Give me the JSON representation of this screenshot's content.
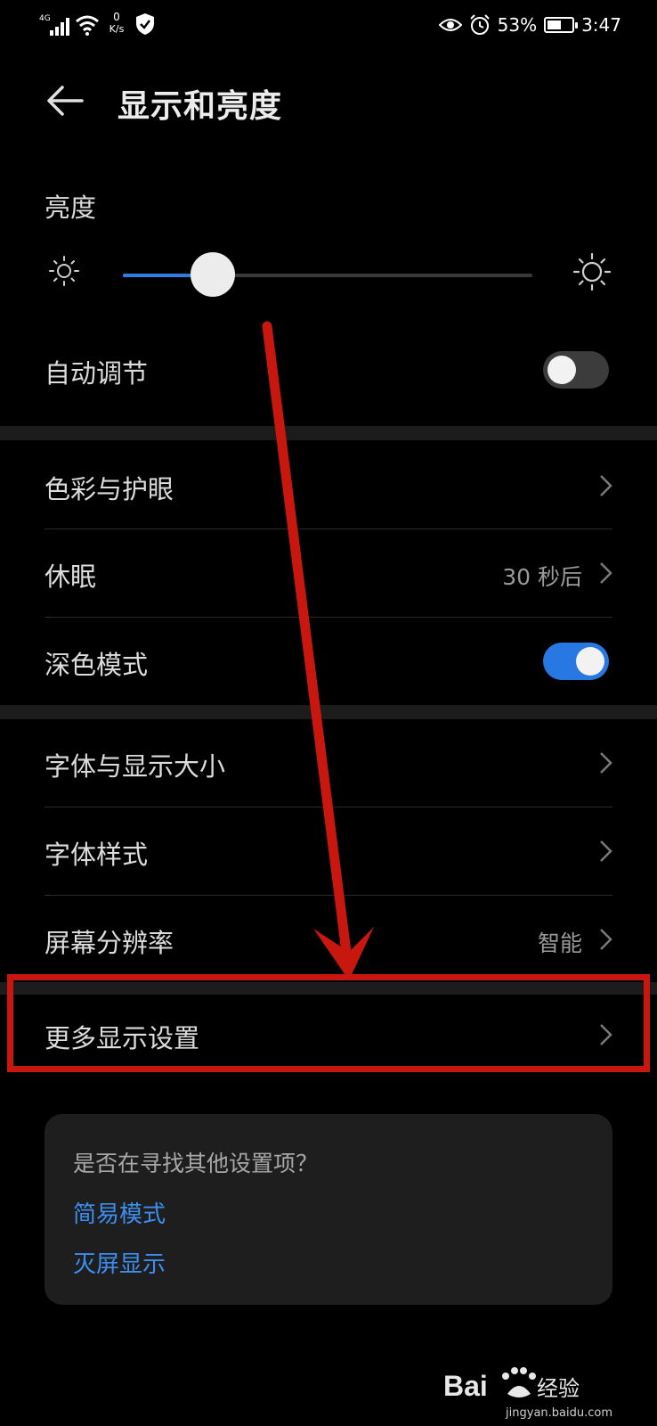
{
  "status_bar": {
    "network": "4G",
    "speed_value": "0",
    "speed_unit": "K/s",
    "battery_percent": "53%",
    "battery_level": 0.53,
    "time": "3:47",
    "icons": [
      "signal-icon",
      "wifi-icon",
      "shield-icon",
      "eye-icon",
      "alarm-icon",
      "battery-icon"
    ]
  },
  "header": {
    "title": "显示和亮度",
    "back_icon": "back-arrow-icon"
  },
  "brightness": {
    "label": "亮度",
    "level": 0.22,
    "accent_color": "#2f7de1"
  },
  "settings": {
    "auto_adjust": {
      "label": "自动调节",
      "enabled": false
    },
    "color_eye": {
      "label": "色彩与护眼"
    },
    "sleep": {
      "label": "休眠",
      "value": "30 秒后"
    },
    "dark_mode": {
      "label": "深色模式",
      "enabled": true
    },
    "font_display_size": {
      "label": "字体与显示大小"
    },
    "font_style": {
      "label": "字体样式"
    },
    "resolution": {
      "label": "屏幕分辨率",
      "value": "智能"
    },
    "more_display": {
      "label": "更多显示设置"
    }
  },
  "suggestion": {
    "question": "是否在寻找其他设置项？",
    "links": [
      "简易模式",
      "灭屏显示"
    ],
    "link_color": "#3d8ef0"
  },
  "annotation": {
    "color": "#c8170f"
  },
  "watermark": {
    "brand": "Bai",
    "brand_suffix": "经验",
    "url": "jingyan.baidu.com"
  }
}
